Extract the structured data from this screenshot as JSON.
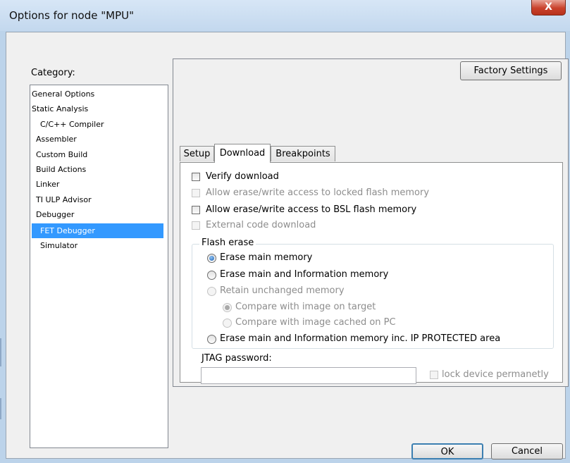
{
  "window": {
    "title": "Options for node \"MPU\"",
    "close_glyph": "X"
  },
  "category": {
    "label": "Category:",
    "items": [
      {
        "label": "General Options"
      },
      {
        "label": "Static Analysis"
      },
      {
        "label": "C/C++ Compiler"
      },
      {
        "label": "Assembler"
      },
      {
        "label": "Custom Build"
      },
      {
        "label": "Build Actions"
      },
      {
        "label": "Linker"
      },
      {
        "label": "TI ULP Advisor"
      },
      {
        "label": "Debugger"
      },
      {
        "label": "FET Debugger",
        "selected": true
      },
      {
        "label": "Simulator"
      }
    ]
  },
  "factory_settings_label": "Factory Settings",
  "tabs": [
    {
      "label": "Setup"
    },
    {
      "label": "Download",
      "active": true
    },
    {
      "label": "Breakpoints"
    }
  ],
  "download": {
    "checkboxes": [
      {
        "label": "Verify download",
        "checked": false,
        "enabled": true
      },
      {
        "label": "Allow erase/write access to locked flash memory",
        "checked": false,
        "enabled": false
      },
      {
        "label": "Allow erase/write access to BSL flash memory",
        "checked": false,
        "enabled": true
      },
      {
        "label": "External code download",
        "checked": false,
        "enabled": false
      }
    ],
    "flash_erase": {
      "legend": "Flash erase",
      "options": [
        {
          "label": "Erase main memory",
          "checked": true,
          "enabled": true
        },
        {
          "label": "Erase main and Information memory",
          "checked": false,
          "enabled": true
        },
        {
          "label": "Retain unchanged memory",
          "checked": false,
          "enabled": false
        },
        {
          "label": "Compare with image on target",
          "checked": true,
          "enabled": false
        },
        {
          "label": "Compare with image cached on PC",
          "checked": false,
          "enabled": false
        },
        {
          "label": "Erase main and Information memory inc. IP PROTECTED area",
          "checked": false,
          "enabled": true
        }
      ]
    },
    "jtag": {
      "label": "JTAG password:",
      "value": "",
      "lock_label": "lock device permanetly",
      "lock_checked": false,
      "lock_enabled": false
    }
  },
  "buttons": {
    "ok": "OK",
    "cancel": "Cancel"
  },
  "colors": {
    "selection": "#3399ff",
    "close_button": "#c9412b",
    "frame": "#bcd3ea"
  }
}
